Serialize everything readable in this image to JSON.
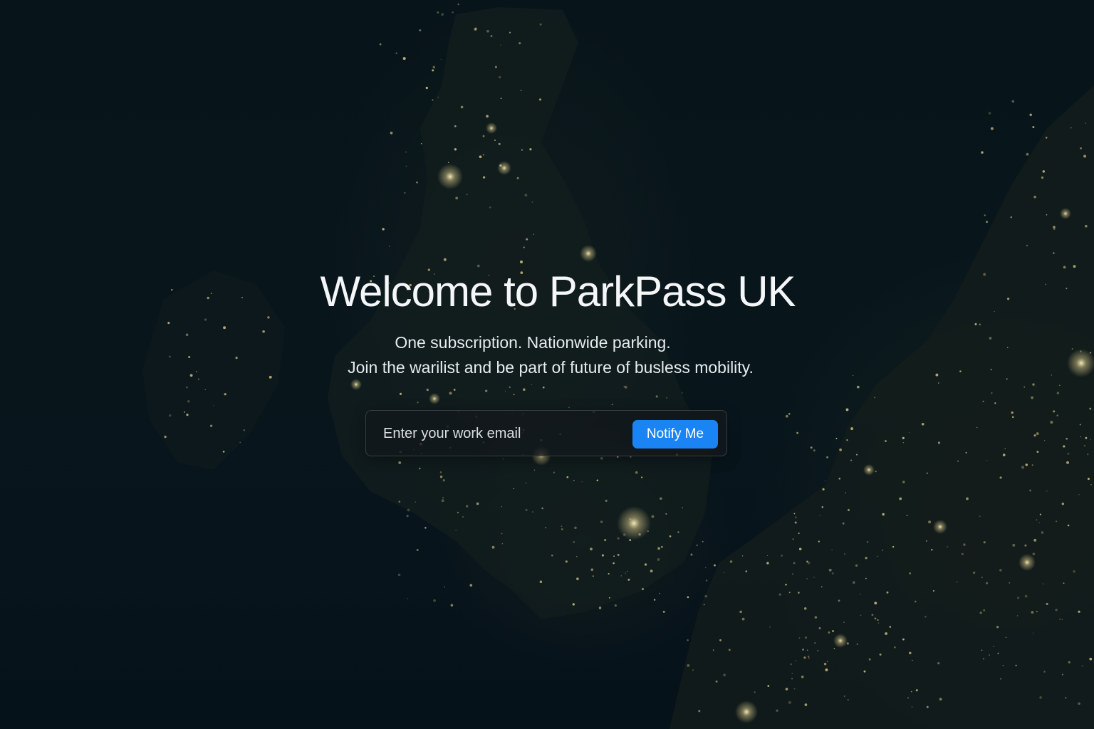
{
  "hero": {
    "title": "Welcome to ParkPass UK",
    "subtitle_line1": "One subscription. Nationwide parking.",
    "subtitle_line2": "Join the warilist and be part of future of busless mobility."
  },
  "signup": {
    "email_placeholder": "Enter your work email",
    "email_value": "",
    "button_label": "Notify Me"
  },
  "theme": {
    "background": "#07131a",
    "accent": "#1a84f4",
    "city_lights": "#d8c98a"
  },
  "background_image": "night-satellite-map-of-uk-and-europe"
}
